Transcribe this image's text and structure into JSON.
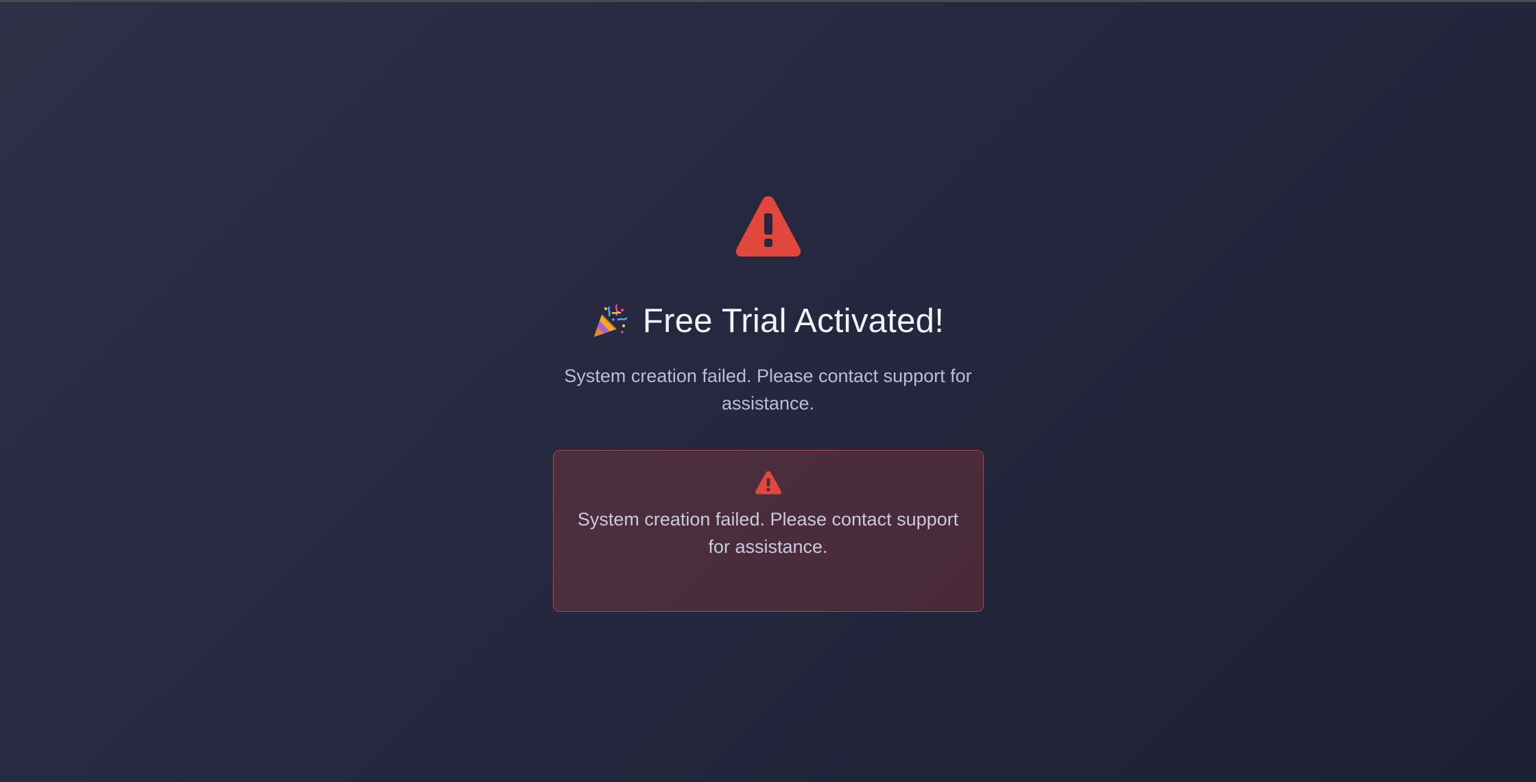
{
  "hero": {
    "icon": "warning-triangle-icon",
    "icon_color": "#e2473b"
  },
  "title": {
    "icon": "party-popper-icon",
    "text": "Free Trial Activated!"
  },
  "subtitle": "System creation failed. Please contact support for assistance.",
  "alert": {
    "icon": "warning-triangle-icon",
    "message": "System creation failed. Please contact support for assistance.",
    "border_color": "#b5434a",
    "icon_color": "#e2473b"
  }
}
